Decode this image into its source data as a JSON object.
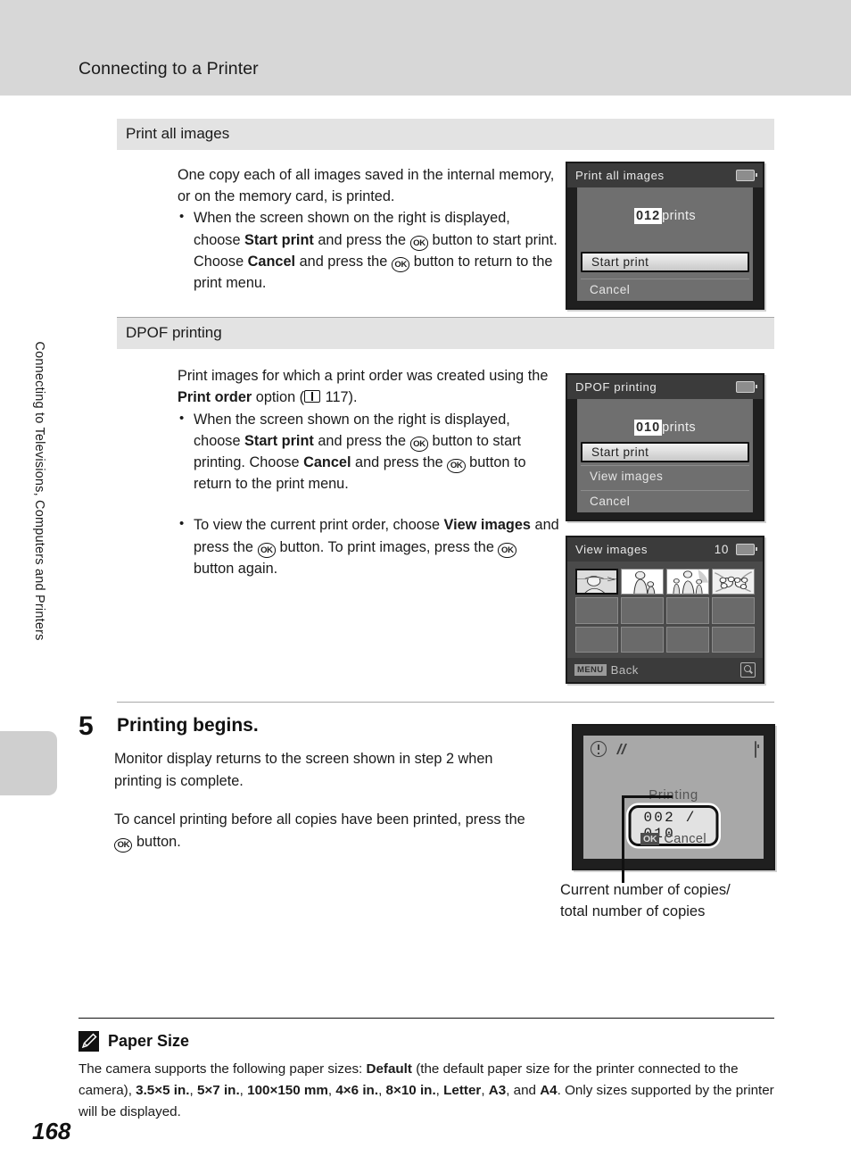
{
  "header": {
    "title": "Connecting to a Printer"
  },
  "side": {
    "chapter": "Connecting to Televisions, Computers and Printers"
  },
  "page_number": "168",
  "sections": [
    {
      "bar_label": "Print all images",
      "intro": "One copy each of all images saved in the internal memory, or on the memory card, is printed.",
      "bullets": [
        {
          "parts": [
            {
              "t": "When the screen shown on the right is displayed, choose ",
              "b": false
            },
            {
              "t": "Start print",
              "b": true
            },
            {
              "t": " and press the ",
              "b": false
            },
            {
              "t": "OK_ICON",
              "b": false
            },
            {
              "t": " button to start print. Choose ",
              "b": false
            },
            {
              "t": "Cancel",
              "b": true
            },
            {
              "t": " and press the ",
              "b": false
            },
            {
              "t": "OK_ICON",
              "b": false
            },
            {
              "t": " button to return to the print menu.",
              "b": false
            }
          ]
        }
      ]
    },
    {
      "bar_label": "DPOF printing",
      "intro_parts": [
        {
          "t": "Print images for which a print order was created using the ",
          "b": false
        },
        {
          "t": "Print order",
          "b": true
        },
        {
          "t": " option (",
          "b": false
        },
        {
          "t": "BOOK_ICON",
          "b": false
        },
        {
          "t": " 117).",
          "b": false
        }
      ],
      "bullets": [
        {
          "parts": [
            {
              "t": "When the screen shown on the right is displayed, choose ",
              "b": false
            },
            {
              "t": "Start print",
              "b": true
            },
            {
              "t": " and press the ",
              "b": false
            },
            {
              "t": "OK_ICON",
              "b": false
            },
            {
              "t": " button to start printing. Choose ",
              "b": false
            },
            {
              "t": "Cancel",
              "b": true
            },
            {
              "t": " and press the ",
              "b": false
            },
            {
              "t": "OK_ICON",
              "b": false
            },
            {
              "t": " button to return to the print menu.",
              "b": false
            }
          ]
        },
        {
          "parts": [
            {
              "t": "To view the current print order, choose ",
              "b": false
            },
            {
              "t": "View images",
              "b": true
            },
            {
              "t": " and press the ",
              "b": false
            },
            {
              "t": "OK_ICON",
              "b": false
            },
            {
              "t": " button. To print images, press the ",
              "b": false
            },
            {
              "t": "OK_ICON",
              "b": false
            },
            {
              "t": " button again.",
              "b": false
            }
          ]
        }
      ]
    }
  ],
  "screens": {
    "print_all": {
      "title": "Print all images",
      "battery_icon": "battery-icon",
      "count": "012",
      "count_unit": "prints",
      "menu": [
        {
          "label": "Start print",
          "selected": true
        },
        {
          "label": "Cancel",
          "selected": false
        }
      ]
    },
    "dpof": {
      "title": "DPOF printing",
      "battery_icon": "battery-icon",
      "count": "010",
      "count_unit": "prints",
      "menu": [
        {
          "label": "Start print",
          "selected": true
        },
        {
          "label": "View images",
          "selected": false
        },
        {
          "label": "Cancel",
          "selected": false
        }
      ]
    },
    "view_images": {
      "title": "View images",
      "count": "10",
      "battery_icon": "battery-icon",
      "footer_badge": "MENU",
      "footer_label": "Back",
      "zoom_icon": "magnifier-icon",
      "thumbnails": [
        {
          "alt": "portrait-with-hat"
        },
        {
          "alt": "woman-with-child"
        },
        {
          "alt": "family-group"
        },
        {
          "alt": "flowers"
        }
      ]
    },
    "printing": {
      "warning_icon": "exclamation-circle-icon",
      "shake_icon": "camera-shake-icon",
      "battery_icon": "battery-icon",
      "label": "Printing",
      "counter": "002 / 010",
      "ok_badge": "OK",
      "cancel_label": "Cancel"
    }
  },
  "callout": {
    "line1": "Current number of copies/",
    "line2": "total number of copies"
  },
  "step": {
    "number": "5",
    "title": "Printing begins.",
    "para1": "Monitor display returns to the screen shown in step 2 when printing is complete.",
    "para2_parts": [
      {
        "t": "To cancel printing before all copies have been printed, press the ",
        "b": false
      },
      {
        "t": "OK_ICON",
        "b": false
      },
      {
        "t": " button.",
        "b": false
      }
    ]
  },
  "note": {
    "icon": "pencil-icon",
    "title": "Paper Size",
    "body_parts": [
      {
        "t": "The camera supports the following paper sizes: ",
        "b": false
      },
      {
        "t": "Default",
        "b": true
      },
      {
        "t": " (the default paper size for the printer connected to the camera), ",
        "b": false
      },
      {
        "t": "3.5×5 in.",
        "b": true
      },
      {
        "t": ", ",
        "b": false
      },
      {
        "t": "5×7 in.",
        "b": true
      },
      {
        "t": ", ",
        "b": false
      },
      {
        "t": "100×150 mm",
        "b": true
      },
      {
        "t": ", ",
        "b": false
      },
      {
        "t": "4×6 in.",
        "b": true
      },
      {
        "t": ", ",
        "b": false
      },
      {
        "t": "8×10 in.",
        "b": true
      },
      {
        "t": ", ",
        "b": false
      },
      {
        "t": "Letter",
        "b": true
      },
      {
        "t": ", ",
        "b": false
      },
      {
        "t": "A3",
        "b": true
      },
      {
        "t": ", and ",
        "b": false
      },
      {
        "t": "A4",
        "b": true
      },
      {
        "t": ". Only sizes supported by the printer will be displayed.",
        "b": false
      }
    ]
  },
  "colors": {
    "header_bg": "#d7d7d7",
    "section_bar_bg": "#e3e3e3",
    "lcd_header_bg": "#3b3b3b",
    "lcd_body_bg": "#6f6f6f",
    "printing_body_bg": "#a8a8a8"
  }
}
